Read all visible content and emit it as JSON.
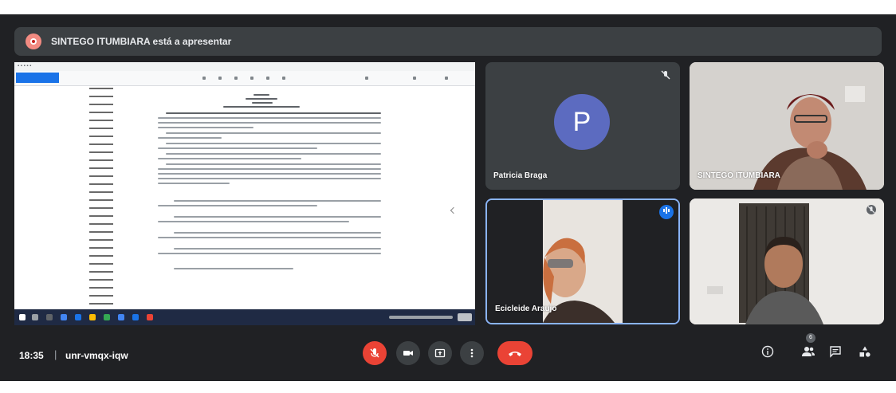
{
  "banner": {
    "text": "SINTEGO ITUMBIARA está a apresentar"
  },
  "participants": {
    "patricia": {
      "name": "Patricia Braga",
      "initial": "P"
    },
    "sintego": {
      "name": "SINTEGO ITUMBIARA"
    },
    "ecicleide": {
      "name": "Ecicleide Araujo"
    }
  },
  "bottom_bar": {
    "time": "18:35",
    "separator": "|",
    "meeting_code": "unr-vmqx-iqw",
    "participant_count": "6"
  },
  "colors": {
    "background": "#202124",
    "mic_off_red": "#ea4335",
    "leave_red": "#ea4335",
    "avatar_purple": "#5c6bc0",
    "active_speaker_border": "#8ab4f8"
  },
  "icons": {
    "mic": "mic-off-icon",
    "camera": "camera-icon",
    "present": "present-screen-icon",
    "more": "more-options-icon",
    "leave": "hang-up-icon",
    "info": "info-icon",
    "people": "people-icon",
    "chat": "chat-icon",
    "activities": "activities-icon"
  }
}
